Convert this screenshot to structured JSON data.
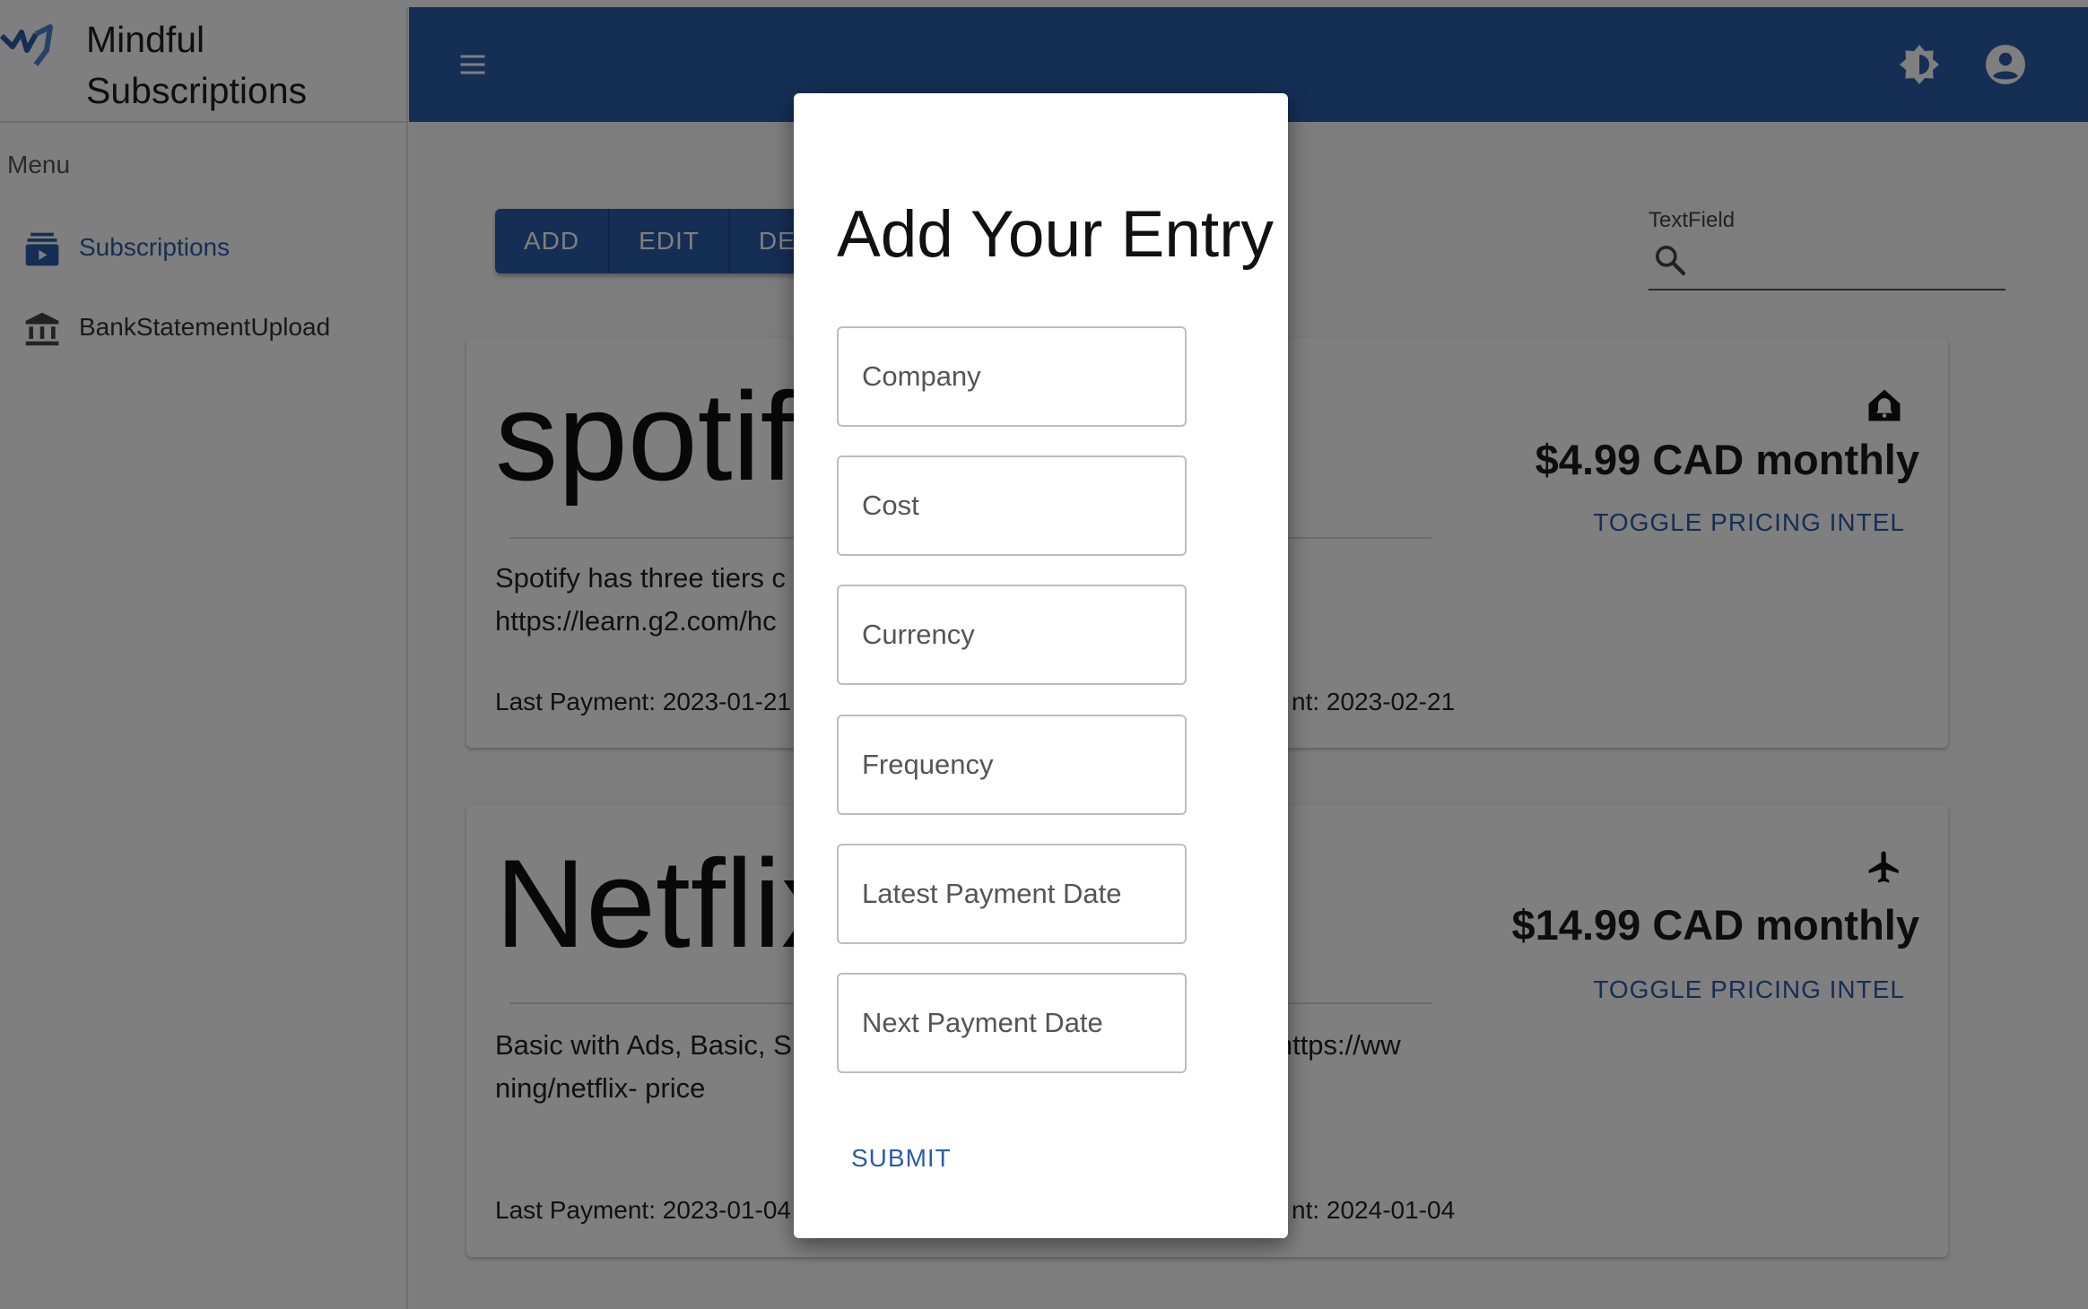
{
  "sidebar": {
    "brand_title": "Mindful Subscriptions",
    "menu_label": "Menu",
    "items": [
      {
        "label": "Subscriptions",
        "icon": "subscriptions-icon",
        "active": true
      },
      {
        "label": "BankStatementUpload",
        "icon": "bank-icon",
        "active": false
      }
    ]
  },
  "appbar": {
    "icons": [
      "menu-icon",
      "brightness-icon",
      "account-circle-icon"
    ],
    "color": "#2b5ca8"
  },
  "toolbar": {
    "add_label": "ADD",
    "edit_label": "EDIT",
    "delete_label": "DEL"
  },
  "search": {
    "label": "TextField",
    "value": ""
  },
  "cards": [
    {
      "title": "spotify",
      "description": "Spotify has three tiers c                                        m. Source: https://freeyourmusic.c                                        m https://learn.g2.com/hc",
      "last_payment": "Last Payment: 2023-01-21",
      "next_payment": "nt: 2023-02-21",
      "price": "$4.99 CAD monthly",
      "toggle_label": "TOGGLE PRICING INTEL",
      "icon": "home-alert-icon"
    },
    {
      "title": "Netflix",
      "description": "Basic with Ads, Basic, S                                        https://www.digitaltren                                        an- breakdown/ https://ww                                        ning/netflix- price",
      "last_payment": "Last Payment: 2023-01-04",
      "next_payment": "nt: 2024-01-04",
      "price": "$14.99 CAD monthly",
      "toggle_label": "TOGGLE PRICING INTEL",
      "icon": "airplane-icon"
    }
  ],
  "dialog": {
    "title": "Add Your Entry",
    "fields": [
      {
        "placeholder": "Company",
        "value": ""
      },
      {
        "placeholder": "Cost",
        "value": ""
      },
      {
        "placeholder": "Currency",
        "value": ""
      },
      {
        "placeholder": "Frequency",
        "value": ""
      },
      {
        "placeholder": "Latest Payment Date",
        "value": ""
      },
      {
        "placeholder": "Next Payment Date",
        "value": ""
      }
    ],
    "submit_label": "SUBMIT"
  },
  "colors": {
    "accent": "#2a5daa",
    "appbar": "#2b5ca8"
  }
}
